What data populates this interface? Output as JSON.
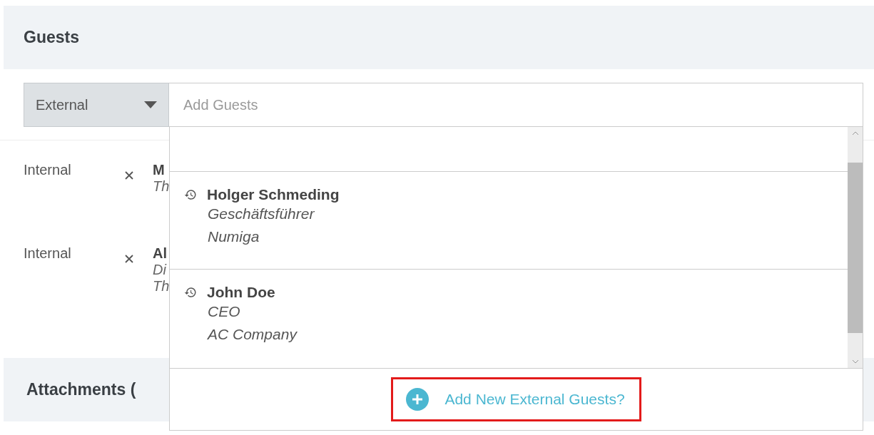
{
  "section": {
    "title": "Guests"
  },
  "guest_type": {
    "value": "External"
  },
  "guest_search": {
    "placeholder": "Add Guests"
  },
  "guests": [
    {
      "type": "Internal",
      "name": "M",
      "lines": [
        "Th"
      ]
    },
    {
      "type": "Internal",
      "name": "Al",
      "lines": [
        "Di",
        "Th"
      ]
    }
  ],
  "suggestions": [
    {
      "name": "Holger Schmeding",
      "title": "Geschäftsführer",
      "company": "Numiga"
    },
    {
      "name": "John Doe",
      "title": "CEO",
      "company": "AC Company"
    }
  ],
  "add_new": {
    "label": "Add New External Guests?",
    "highlighted": true
  },
  "next_section": {
    "title": "Attachments ("
  }
}
